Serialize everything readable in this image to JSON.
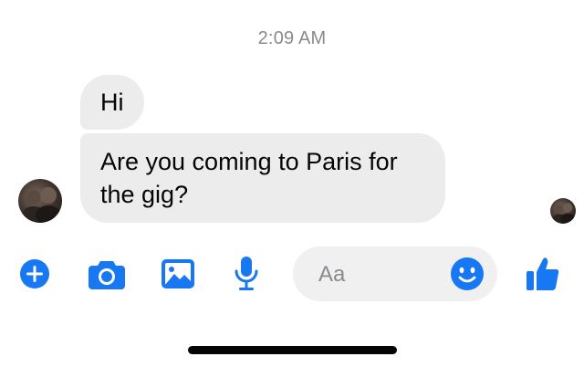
{
  "conversation": {
    "timestamp": "2:09 AM",
    "messages": [
      {
        "sender": "contact",
        "text": "Hi"
      },
      {
        "sender": "contact",
        "text": "Are you coming to Paris for the gig?"
      }
    ]
  },
  "composer": {
    "placeholder": "Aa",
    "icons": [
      "plus-icon",
      "camera-icon",
      "image-icon",
      "microphone-icon",
      "smile-icon",
      "thumbs-up-icon"
    ]
  },
  "colors": {
    "accent": "#1877f2",
    "bubble": "#ececec",
    "timestamp": "#8a8a8e"
  }
}
